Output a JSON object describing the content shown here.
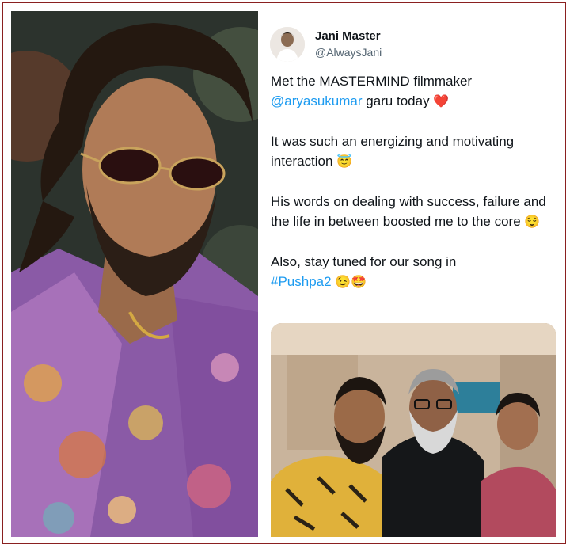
{
  "tweet": {
    "author_name": "Jani Master",
    "author_handle": "@AlwaysJani",
    "line1_text": "Met the MASTERMIND filmmaker",
    "mention": "@aryasukumar",
    "line2_text": " garu today ",
    "emoji_heart": "❤️",
    "para2_text": "It was such an energizing and motivating interaction ",
    "emoji_halo": "😇",
    "para3_text": "His words on dealing with success, failure and the life in between boosted me to the core ",
    "emoji_relieved": "😌",
    "para4_text": "Also, stay tuned for our song in",
    "hashtag": "#Pushpa2",
    "emoji_wink": "😉",
    "emoji_starstruck": "🤩"
  },
  "images": {
    "left_photo": "portrait-man-sunglasses-floral-shirt",
    "right_photo": "selfie-three-people"
  },
  "colors": {
    "frame_border": "#8a2020",
    "link_blue": "#1d9bf0",
    "text": "#0f1419",
    "secondary_text": "#536471"
  }
}
